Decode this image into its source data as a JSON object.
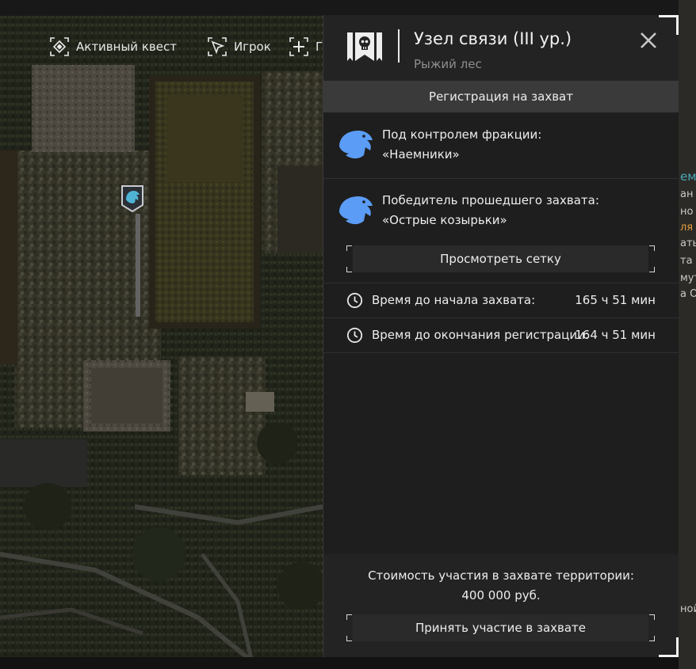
{
  "map": {
    "legend": [
      {
        "icon": "active-quest-icon",
        "label": "Активный квест"
      },
      {
        "icon": "player-arrow-icon",
        "label": "Игрок"
      },
      {
        "icon": "plus-icon",
        "label": "Г"
      }
    ]
  },
  "background_window": {
    "fragments": [
      "ем",
      "ан",
      "но С",
      "ля",
      "ать с",
      "та С",
      "мут",
      "а О",
      "ной"
    ]
  },
  "panel": {
    "emblem_icon": "skull-banner-icon",
    "title": "Узел связи (III ур.)",
    "location": "Рыжий лес",
    "close_icon": "close-icon",
    "registration_tab": "Регистрация на захват",
    "control": {
      "icon": "eagle-faction-icon",
      "label": "Под контролем фракции:",
      "value": "«Наемники»"
    },
    "winner": {
      "icon": "eagle-faction-icon",
      "label": "Победитель прошедшего захвата:",
      "value": "«Острые козырьки»",
      "button": "Просмотреть сетку"
    },
    "timers": [
      {
        "icon": "clock-icon",
        "label": "Время до начала захвата:",
        "value": "165 ч 51 мин"
      },
      {
        "icon": "clock-icon",
        "label": "Время до окончания регистрации:",
        "value": "164 ч 51 мин"
      }
    ],
    "cost": {
      "label": "Стоимость участия в захвате территории:",
      "value": "400 000 руб.",
      "button": "Принять участие в захвате"
    }
  },
  "colors": {
    "faction_eagle": "#5b9cf6",
    "panel_bg": "#1e1e1e",
    "tab_bg": "#3a3a3a",
    "highlight_text": "#e39a3a",
    "teal_text": "#4aa8b8"
  }
}
